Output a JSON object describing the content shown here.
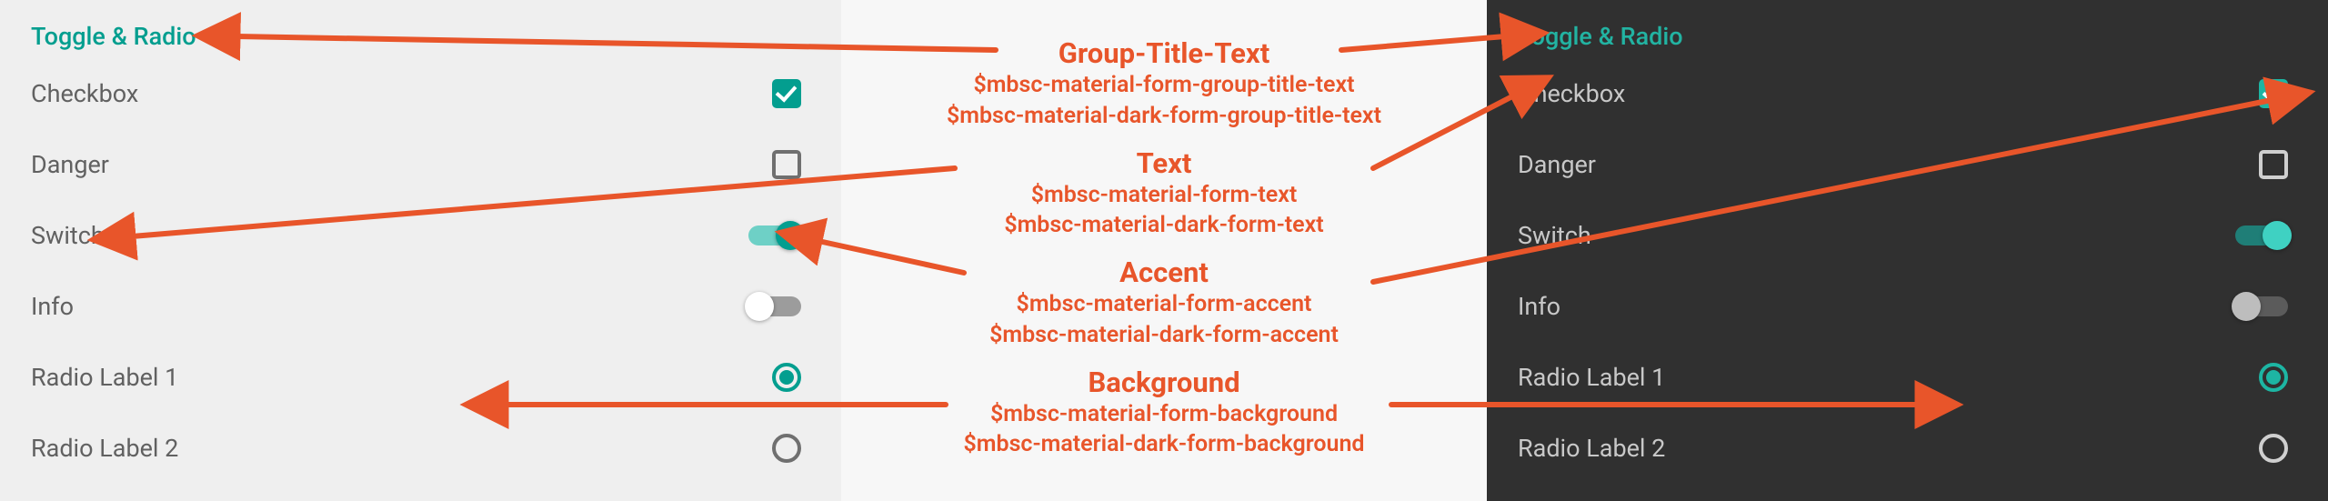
{
  "colors": {
    "arrow": "#e8552a",
    "accent_light": "#039e8f",
    "accent_dark": "#1db5a3"
  },
  "group_title": "Toggle & Radio",
  "rows": {
    "checkbox": "Checkbox",
    "danger": "Danger",
    "switch": "Switch",
    "info": "Info",
    "radio1": "Radio Label 1",
    "radio2": "Radio Label 2"
  },
  "legend": {
    "group_title_text": {
      "title": "Group-Title-Text",
      "var_light": "$mbsc-material-form-group-title-text",
      "var_dark": "$mbsc-material-dark-form-group-title-text"
    },
    "text": {
      "title": "Text",
      "var_light": "$mbsc-material-form-text",
      "var_dark": "$mbsc-material-dark-form-text"
    },
    "accent": {
      "title": "Accent",
      "var_light": "$mbsc-material-form-accent",
      "var_dark": "$mbsc-material-dark-form-accent"
    },
    "background": {
      "title": "Background",
      "var_light": "$mbsc-material-form-background",
      "var_dark": "$mbsc-material-dark-form-background"
    }
  }
}
